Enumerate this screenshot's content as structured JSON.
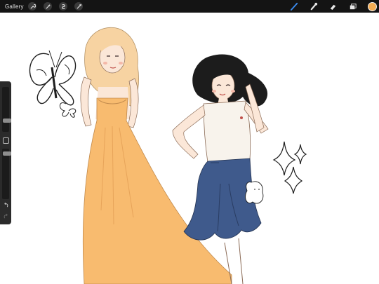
{
  "topbar": {
    "gallery_label": "Gallery",
    "left_tools": [
      "wrench-icon",
      "magic-wand-icon",
      "selection-icon",
      "transform-icon"
    ],
    "right_tools": [
      "brush-icon",
      "smudge-icon",
      "eraser-icon",
      "layers-icon"
    ],
    "active_tool": "brush-icon",
    "current_color": "#f5ad53"
  },
  "sidebar": {
    "brush_size_level": 0.2,
    "opacity_level": 0.2,
    "buttons": [
      "modify-square",
      "undo-icon",
      "redo-icon"
    ]
  },
  "canvas": {
    "background": "#ffffff",
    "dress_color": "#f8bb6f",
    "jeans_color": "#3f5a8c",
    "hair_blonde": "#f7d3a2",
    "hair_dark": "#1c1c1c",
    "skin_tone": "#fbe7d8"
  }
}
